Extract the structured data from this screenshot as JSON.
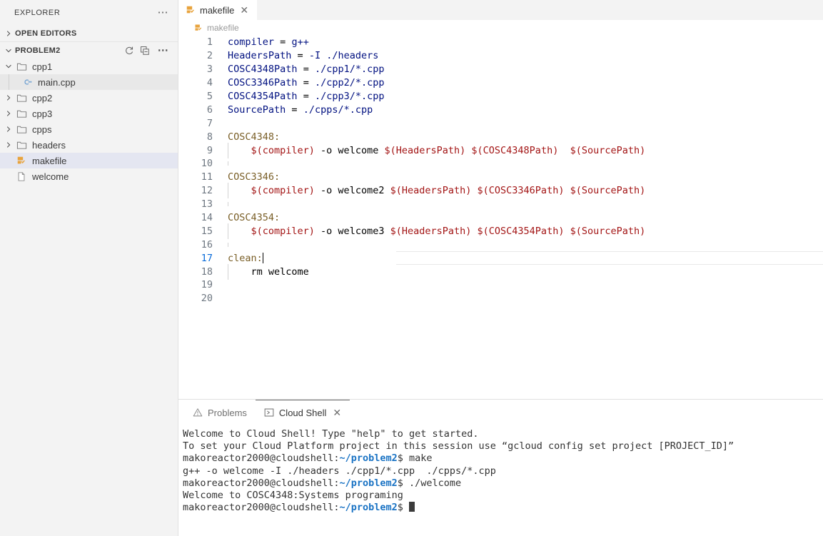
{
  "sidebar": {
    "title": "EXPLORER",
    "more_label": "⋯",
    "open_editors": {
      "label": "OPEN EDITORS"
    },
    "workspace": {
      "label": "PROBLEM2",
      "actions": [
        "refresh-icon",
        "collapse-all-icon",
        "more-actions-icon"
      ]
    },
    "tree": [
      {
        "name": "cpp1",
        "type": "folder",
        "expanded": true,
        "depth": 0,
        "icon": "folder-icon",
        "selected": false
      },
      {
        "name": "main.cpp",
        "type": "file",
        "expanded": false,
        "depth": 1,
        "icon": "cpp-file-icon",
        "selected": false,
        "hover": true
      },
      {
        "name": "cpp2",
        "type": "folder",
        "expanded": false,
        "depth": 0,
        "icon": "folder-icon",
        "selected": false
      },
      {
        "name": "cpp3",
        "type": "folder",
        "expanded": false,
        "depth": 0,
        "icon": "folder-icon",
        "selected": false
      },
      {
        "name": "cpps",
        "type": "folder",
        "expanded": false,
        "depth": 0,
        "icon": "folder-icon",
        "selected": false
      },
      {
        "name": "headers",
        "type": "folder",
        "expanded": false,
        "depth": 0,
        "icon": "folder-icon",
        "selected": false
      },
      {
        "name": "makefile",
        "type": "file",
        "expanded": false,
        "depth": 0,
        "icon": "makefile-icon",
        "selected": true
      },
      {
        "name": "welcome",
        "type": "file",
        "expanded": false,
        "depth": 0,
        "icon": "plain-file-icon",
        "selected": false
      }
    ]
  },
  "editor": {
    "tab": {
      "label": "makefile",
      "icon": "makefile-icon",
      "close": "✕"
    },
    "breadcrumb": {
      "label": "makefile",
      "icon": "makefile-icon"
    },
    "total_lines": 20,
    "cursor_line": 17,
    "lines": [
      {
        "n": 1,
        "indent": false,
        "tokens": [
          {
            "t": "compiler",
            "c": "var"
          },
          {
            "t": " ",
            "c": "plain"
          },
          {
            "t": "=",
            "c": "op"
          },
          {
            "t": " ",
            "c": "plain"
          },
          {
            "t": "g++",
            "c": "var"
          }
        ]
      },
      {
        "n": 2,
        "indent": false,
        "tokens": [
          {
            "t": "HeadersPath",
            "c": "var"
          },
          {
            "t": " ",
            "c": "plain"
          },
          {
            "t": "=",
            "c": "op"
          },
          {
            "t": " ",
            "c": "plain"
          },
          {
            "t": "-I ./headers",
            "c": "var"
          }
        ]
      },
      {
        "n": 3,
        "indent": false,
        "tokens": [
          {
            "t": "COSC4348Path",
            "c": "var"
          },
          {
            "t": " ",
            "c": "plain"
          },
          {
            "t": "=",
            "c": "op"
          },
          {
            "t": " ",
            "c": "plain"
          },
          {
            "t": "./cpp1/*.cpp",
            "c": "var"
          }
        ]
      },
      {
        "n": 4,
        "indent": false,
        "tokens": [
          {
            "t": "COSC3346Path",
            "c": "var"
          },
          {
            "t": " ",
            "c": "plain"
          },
          {
            "t": "=",
            "c": "op"
          },
          {
            "t": " ",
            "c": "plain"
          },
          {
            "t": "./cpp2/*.cpp",
            "c": "var"
          }
        ]
      },
      {
        "n": 5,
        "indent": false,
        "tokens": [
          {
            "t": "COSC4354Path",
            "c": "var"
          },
          {
            "t": " ",
            "c": "plain"
          },
          {
            "t": "=",
            "c": "op"
          },
          {
            "t": " ",
            "c": "plain"
          },
          {
            "t": "./cpp3/*.cpp",
            "c": "var"
          }
        ]
      },
      {
        "n": 6,
        "indent": false,
        "tokens": [
          {
            "t": "SourcePath",
            "c": "var"
          },
          {
            "t": " ",
            "c": "plain"
          },
          {
            "t": "=",
            "c": "op"
          },
          {
            "t": " ",
            "c": "plain"
          },
          {
            "t": "./cpps/*.cpp",
            "c": "var"
          }
        ]
      },
      {
        "n": 7,
        "indent": false,
        "tokens": []
      },
      {
        "n": 8,
        "indent": false,
        "tokens": [
          {
            "t": "COSC4348:",
            "c": "target"
          }
        ]
      },
      {
        "n": 9,
        "indent": true,
        "tokens": [
          {
            "t": "    ",
            "c": "plain"
          },
          {
            "t": "$(compiler)",
            "c": "macro"
          },
          {
            "t": " -o welcome ",
            "c": "plain"
          },
          {
            "t": "$(HeadersPath)",
            "c": "macro"
          },
          {
            "t": " ",
            "c": "plain"
          },
          {
            "t": "$(COSC4348Path)",
            "c": "macro"
          },
          {
            "t": "  ",
            "c": "plain"
          },
          {
            "t": "$(SourcePath)",
            "c": "macro"
          }
        ]
      },
      {
        "n": 10,
        "indent": true,
        "tokens": []
      },
      {
        "n": 11,
        "indent": false,
        "tokens": [
          {
            "t": "COSC3346:",
            "c": "target"
          }
        ]
      },
      {
        "n": 12,
        "indent": true,
        "tokens": [
          {
            "t": "    ",
            "c": "plain"
          },
          {
            "t": "$(compiler)",
            "c": "macro"
          },
          {
            "t": " -o welcome2 ",
            "c": "plain"
          },
          {
            "t": "$(HeadersPath)",
            "c": "macro"
          },
          {
            "t": " ",
            "c": "plain"
          },
          {
            "t": "$(COSC3346Path)",
            "c": "macro"
          },
          {
            "t": " ",
            "c": "plain"
          },
          {
            "t": "$(SourcePath)",
            "c": "macro"
          }
        ]
      },
      {
        "n": 13,
        "indent": true,
        "tokens": []
      },
      {
        "n": 14,
        "indent": false,
        "tokens": [
          {
            "t": "COSC4354:",
            "c": "target"
          }
        ]
      },
      {
        "n": 15,
        "indent": true,
        "tokens": [
          {
            "t": "    ",
            "c": "plain"
          },
          {
            "t": "$(compiler)",
            "c": "macro"
          },
          {
            "t": " -o welcome3 ",
            "c": "plain"
          },
          {
            "t": "$(HeadersPath)",
            "c": "macro"
          },
          {
            "t": " ",
            "c": "plain"
          },
          {
            "t": "$(COSC4354Path)",
            "c": "macro"
          },
          {
            "t": " ",
            "c": "plain"
          },
          {
            "t": "$(SourcePath)",
            "c": "macro"
          }
        ]
      },
      {
        "n": 16,
        "indent": true,
        "tokens": []
      },
      {
        "n": 17,
        "indent": false,
        "current": true,
        "caret": true,
        "tokens": [
          {
            "t": "clean:",
            "c": "target"
          }
        ]
      },
      {
        "n": 18,
        "indent": true,
        "tokens": [
          {
            "t": "    ",
            "c": "plain"
          },
          {
            "t": "rm welcome",
            "c": "plain"
          }
        ]
      },
      {
        "n": 19,
        "indent": false,
        "tokens": []
      },
      {
        "n": 20,
        "indent": false,
        "tokens": []
      }
    ]
  },
  "panel": {
    "tabs": [
      {
        "label": "Problems",
        "icon": "warning-triangle-icon",
        "active": false,
        "closable": false
      },
      {
        "label": "Cloud Shell",
        "icon": "terminal-icon",
        "active": true,
        "closable": true,
        "close": "✕"
      }
    ],
    "terminal": {
      "lines": [
        {
          "parts": [
            {
              "t": "Welcome to Cloud Shell! Type \"help\" to get started.",
              "c": "plain"
            }
          ]
        },
        {
          "parts": [
            {
              "t": "To set your Cloud Platform project in this session use “gcloud config set project [PROJECT_ID]”",
              "c": "plain"
            }
          ]
        },
        {
          "parts": [
            {
              "t": "makoreactor2000@cloudshell:",
              "c": "plain"
            },
            {
              "t": "~/problem2",
              "c": "path"
            },
            {
              "t": "$ make",
              "c": "plain"
            }
          ]
        },
        {
          "parts": [
            {
              "t": "g++ -o welcome -I ./headers ./cpp1/*.cpp  ./cpps/*.cpp",
              "c": "plain"
            }
          ]
        },
        {
          "parts": [
            {
              "t": "makoreactor2000@cloudshell:",
              "c": "plain"
            },
            {
              "t": "~/problem2",
              "c": "path"
            },
            {
              "t": "$ ./welcome",
              "c": "plain"
            }
          ]
        },
        {
          "parts": [
            {
              "t": "Welcome to COSC4348:Systems programing",
              "c": "plain"
            }
          ]
        },
        {
          "parts": [
            {
              "t": "makoreactor2000@cloudshell:",
              "c": "plain"
            },
            {
              "t": "~/problem2",
              "c": "path"
            },
            {
              "t": "$ ",
              "c": "plain"
            },
            {
              "t": "",
              "c": "cursor"
            }
          ]
        }
      ]
    }
  },
  "colors": {
    "sidebar_bg": "#f3f3f3",
    "editor_bg": "#ffffff",
    "selection": "#e4e6f1",
    "accent_blue": "#1a73c4",
    "macro_red": "#a31515",
    "target_olive": "#795e26",
    "var_navy": "#001080",
    "linenum_gray": "#6e7781",
    "makefile_orange": "#e8a33d"
  }
}
